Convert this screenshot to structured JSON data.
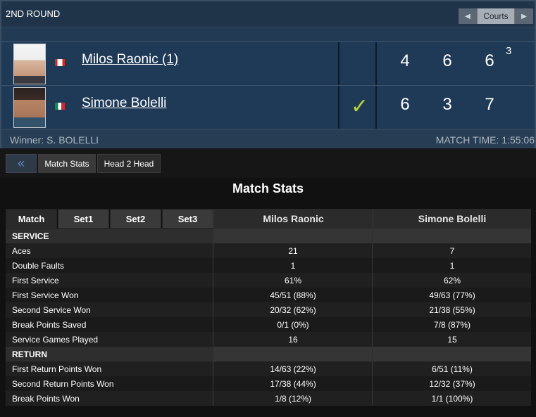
{
  "scoreboard": {
    "round": "2ND ROUND",
    "courts_label": "Courts",
    "players": [
      {
        "name": "Milos Raonic (1)",
        "country": "Canada",
        "winner": false,
        "sets": [
          "4",
          "6",
          "6"
        ],
        "tiebreak": "3"
      },
      {
        "name": "Simone Bolelli",
        "country": "Italy",
        "winner": true,
        "sets": [
          "6",
          "3",
          "7"
        ],
        "tiebreak": ""
      }
    ],
    "winner_text": "Winner: S. BOLELLI",
    "match_time": "MATCH TIME: 1:55:06"
  },
  "tabs": {
    "back": "«",
    "match_stats": "Match Stats",
    "head2head": "Head 2 Head"
  },
  "stats": {
    "title": "Match Stats",
    "set_tabs": [
      "Match",
      "Set1",
      "Set2",
      "Set3"
    ],
    "player1": "Milos Raonic",
    "player2": "Simone Bolelli",
    "rows": [
      {
        "type": "section",
        "label": "SERVICE"
      },
      {
        "label": "Aces",
        "v1": "21",
        "v2": "7"
      },
      {
        "label": "Double Faults",
        "v1": "1",
        "v2": "1"
      },
      {
        "label": "First Service",
        "v1": "61%",
        "v2": "62%"
      },
      {
        "label": "First Service Won",
        "v1": "45/51 (88%)",
        "v2": "49/63 (77%)"
      },
      {
        "label": "Second Service Won",
        "v1": "20/32 (62%)",
        "v2": "21/38 (55%)"
      },
      {
        "label": "Break Points Saved",
        "v1": "0/1 (0%)",
        "v2": "7/8 (87%)"
      },
      {
        "label": "Service Games Played",
        "v1": "16",
        "v2": "15"
      },
      {
        "type": "section",
        "label": "RETURN"
      },
      {
        "label": "First Return Points Won",
        "v1": "14/63 (22%)",
        "v2": "6/51 (11%)"
      },
      {
        "label": "Second Return Points Won",
        "v1": "17/38 (44%)",
        "v2": "12/32 (37%)"
      },
      {
        "label": "Break Points Won",
        "v1": "1/8 (12%)",
        "v2": "1/1 (100%)"
      }
    ]
  },
  "colors": {
    "check": "#b7d433",
    "scoreboard_bg": "#1f3349"
  }
}
